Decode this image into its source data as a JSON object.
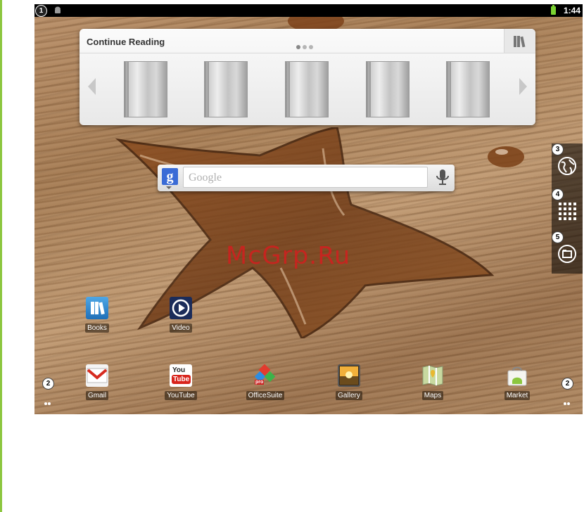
{
  "statusbar": {
    "time": "1:44"
  },
  "callouts": {
    "c1": "1",
    "c2": "2",
    "c3": "3",
    "c4": "4",
    "c5": "5"
  },
  "reading_widget": {
    "title": "Continue Reading",
    "page_indicator": {
      "count": 3,
      "active": 0
    }
  },
  "search": {
    "placeholder": "Google",
    "logo": "g"
  },
  "watermark": "McGrp.Ru",
  "rail_icons": [
    "browser-icon",
    "all-apps-icon",
    "folder-icon"
  ],
  "desktop_apps": [
    {
      "label": "Books",
      "icon": "books-icon"
    },
    {
      "label": "Video",
      "icon": "video-icon"
    }
  ],
  "dock_apps": [
    {
      "label": "Gmail",
      "icon": "gmail-icon"
    },
    {
      "label": "YouTube",
      "icon": "youtube-icon",
      "icon_text": [
        "You",
        "Tube"
      ]
    },
    {
      "label": "OfficeSuite",
      "icon": "officesuite-icon",
      "icon_text": "pro"
    },
    {
      "label": "Gallery",
      "icon": "gallery-icon"
    },
    {
      "label": "Maps",
      "icon": "maps-icon"
    },
    {
      "label": "Market",
      "icon": "market-icon"
    }
  ],
  "colors": {
    "accent_green": "#8cc63f",
    "statusbar": "#000000",
    "watermark": "#d21e1e"
  }
}
